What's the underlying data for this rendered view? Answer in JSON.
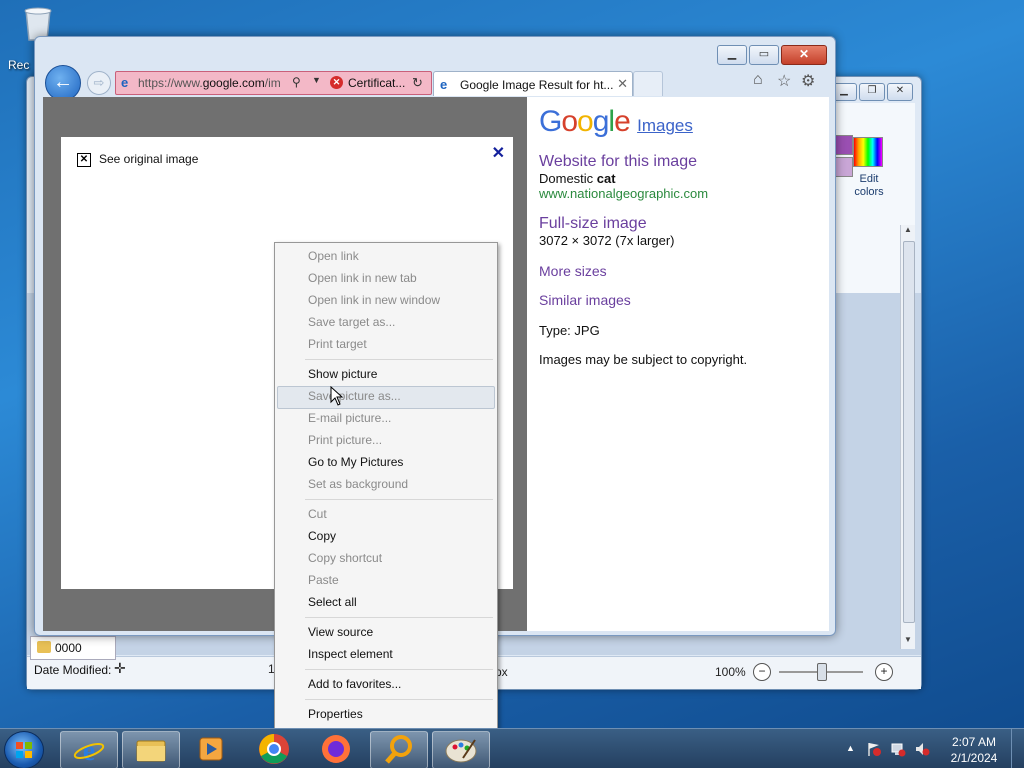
{
  "desktop": {
    "recycle_label": "Rec"
  },
  "paint": {
    "edit_colors_label": "Edit colors",
    "help": "?",
    "zoom": "100%",
    "px_text": "px",
    "zoom_minus": "−",
    "zoom_plus": "+"
  },
  "explorer": {
    "folder_label": "0000",
    "date_modified": "Date Modified:",
    "small_num": "1"
  },
  "ie": {
    "url_prefix": "https://www.",
    "url_domain": "google.com",
    "url_suffix": "/im",
    "cert_text": "Certificat...",
    "tab_title": "Google Image Result for ht...",
    "back_glyph": "←",
    "fwd_glyph": "⇨"
  },
  "image_panel": {
    "see_original": "See original image",
    "close_glyph": "✕"
  },
  "info": {
    "logo_letters": [
      "G",
      "o",
      "o",
      "g",
      "l",
      "e"
    ],
    "images_label": "Images",
    "website_heading": "Website for this image",
    "website_name_prefix": "Domestic ",
    "website_name_bold": "cat",
    "website_url": "www.nationalgeographic.com",
    "fullsize_heading": "Full-size image",
    "fullsize_dims": "3072 × 3072 (7x larger)",
    "more_sizes": "More sizes",
    "similar_images": "Similar images",
    "type_text": "Type:  JPG",
    "copyright": "Images may be subject to copyright."
  },
  "context_menu": {
    "items": [
      {
        "label": "Open link",
        "enabled": false
      },
      {
        "label": "Open link in new tab",
        "enabled": false
      },
      {
        "label": "Open link in new window",
        "enabled": false
      },
      {
        "label": "Save target as...",
        "enabled": false
      },
      {
        "label": "Print target",
        "enabled": false
      },
      {
        "label": "Show picture",
        "enabled": true
      },
      {
        "label": "Save picture as...",
        "enabled": false,
        "hovered": true
      },
      {
        "label": "E-mail picture...",
        "enabled": false
      },
      {
        "label": "Print picture...",
        "enabled": false
      },
      {
        "label": "Go to My Pictures",
        "enabled": true
      },
      {
        "label": "Set as background",
        "enabled": false
      },
      {
        "label": "Cut",
        "enabled": false
      },
      {
        "label": "Copy",
        "enabled": true
      },
      {
        "label": "Copy shortcut",
        "enabled": false
      },
      {
        "label": "Paste",
        "enabled": false
      },
      {
        "label": "Select all",
        "enabled": true
      },
      {
        "label": "View source",
        "enabled": true
      },
      {
        "label": "Inspect element",
        "enabled": true
      },
      {
        "label": "Add to favorites...",
        "enabled": true
      },
      {
        "label": "Properties",
        "enabled": true
      }
    ]
  },
  "taskbar": {
    "apps": [
      "internet-explorer",
      "windows-explorer",
      "media-player",
      "chrome",
      "firefox",
      "search-tool",
      "paint"
    ],
    "time": "2:07 AM",
    "date": "2/1/2024"
  },
  "colors": {
    "address_bar_error": "#f3b8c7",
    "link_purple": "#6a3f9e",
    "url_green": "#2b8a3e"
  }
}
